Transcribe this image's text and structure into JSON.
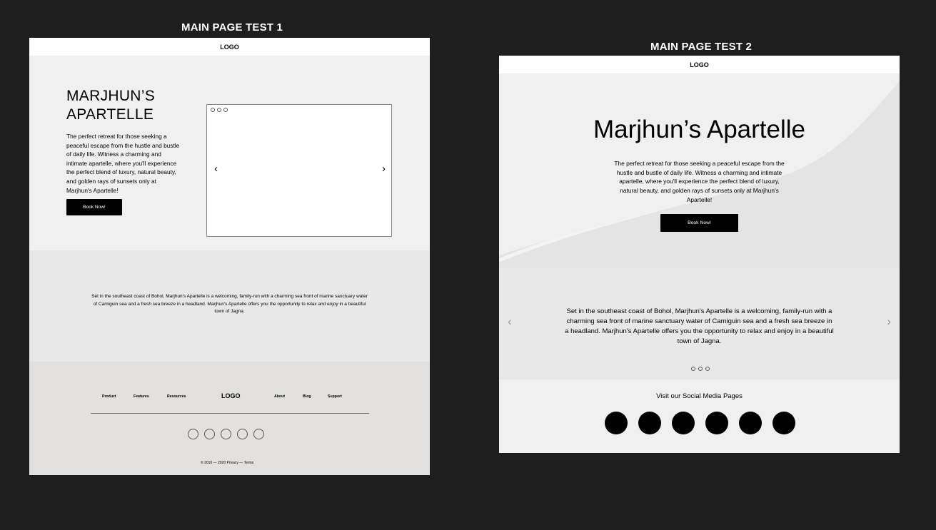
{
  "frame1": {
    "label": "MAIN PAGE TEST 1",
    "logo": "LOGO",
    "hero": {
      "title": "MARJHUN’S APARTELLE",
      "description": "The perfect retreat for those seeking a peaceful escape from the hustle and bustle of daily life. Witness a charming and intimate apartelle, where you'll experience the perfect blend of luxury, natural beauty, and golden rays of sunsets only at Marjhun's Apartelle!",
      "button": "Book Now!",
      "prev_arrow": "‹",
      "next_arrow": "›"
    },
    "about": "Set in the southeast coast of Bohol,  Marjhun's Apartelle is a welcoming, family-run with a charming sea front of marine sanctuary water of Camiguin sea and a fresh sea breeze in a headland. Marjhun's Apartelle offers you the opportunity to relax and enjoy in a beautiful town of Jagna.",
    "footer": {
      "nav_left": [
        "Product",
        "Features",
        "Resources"
      ],
      "logo": "LOGO",
      "nav_right": [
        "About",
        "Blog",
        "Support"
      ],
      "social_icons": [
        "circle-icon",
        "circle-icon",
        "circle-icon",
        "circle-icon",
        "circle-icon"
      ],
      "copyright": "© 2010 — 2020   Privacy — Terms"
    }
  },
  "frame2": {
    "label": "MAIN PAGE TEST 2",
    "logo": "LOGO",
    "hero": {
      "title": "Marjhun’s Apartelle",
      "description": "The perfect retreat for those seeking a peaceful escape from the hustle and bustle of daily life. Witness a charming and intimate apartelle, where you'll experience the perfect blend of luxury, natural beauty, and golden rays of sunsets only at Marjhun's Apartelle!",
      "button": "Book Now!"
    },
    "about": {
      "text": "Set in the southeast coast of Bohol,  Marjhun's Apartelle is a welcoming, family-run with a charming sea front of marine sanctuary water of Camiguin sea and a fresh sea breeze in a headland. Marjhun's Apartelle offers you the opportunity to relax and enjoy in a beautiful town of Jagna.",
      "prev_arrow": "‹",
      "next_arrow": "›"
    },
    "social": {
      "title": "Visit our Social Media Pages",
      "icons": [
        "social-icon-1",
        "social-icon-2",
        "social-icon-3",
        "social-icon-4",
        "social-icon-5",
        "social-icon-6"
      ]
    }
  },
  "colors": {
    "canvas": "#1e1e1e",
    "section_light": "#f0f0f0",
    "section_mid": "#e8e8e8",
    "footer": "#e2e1df",
    "button": "#000000"
  }
}
